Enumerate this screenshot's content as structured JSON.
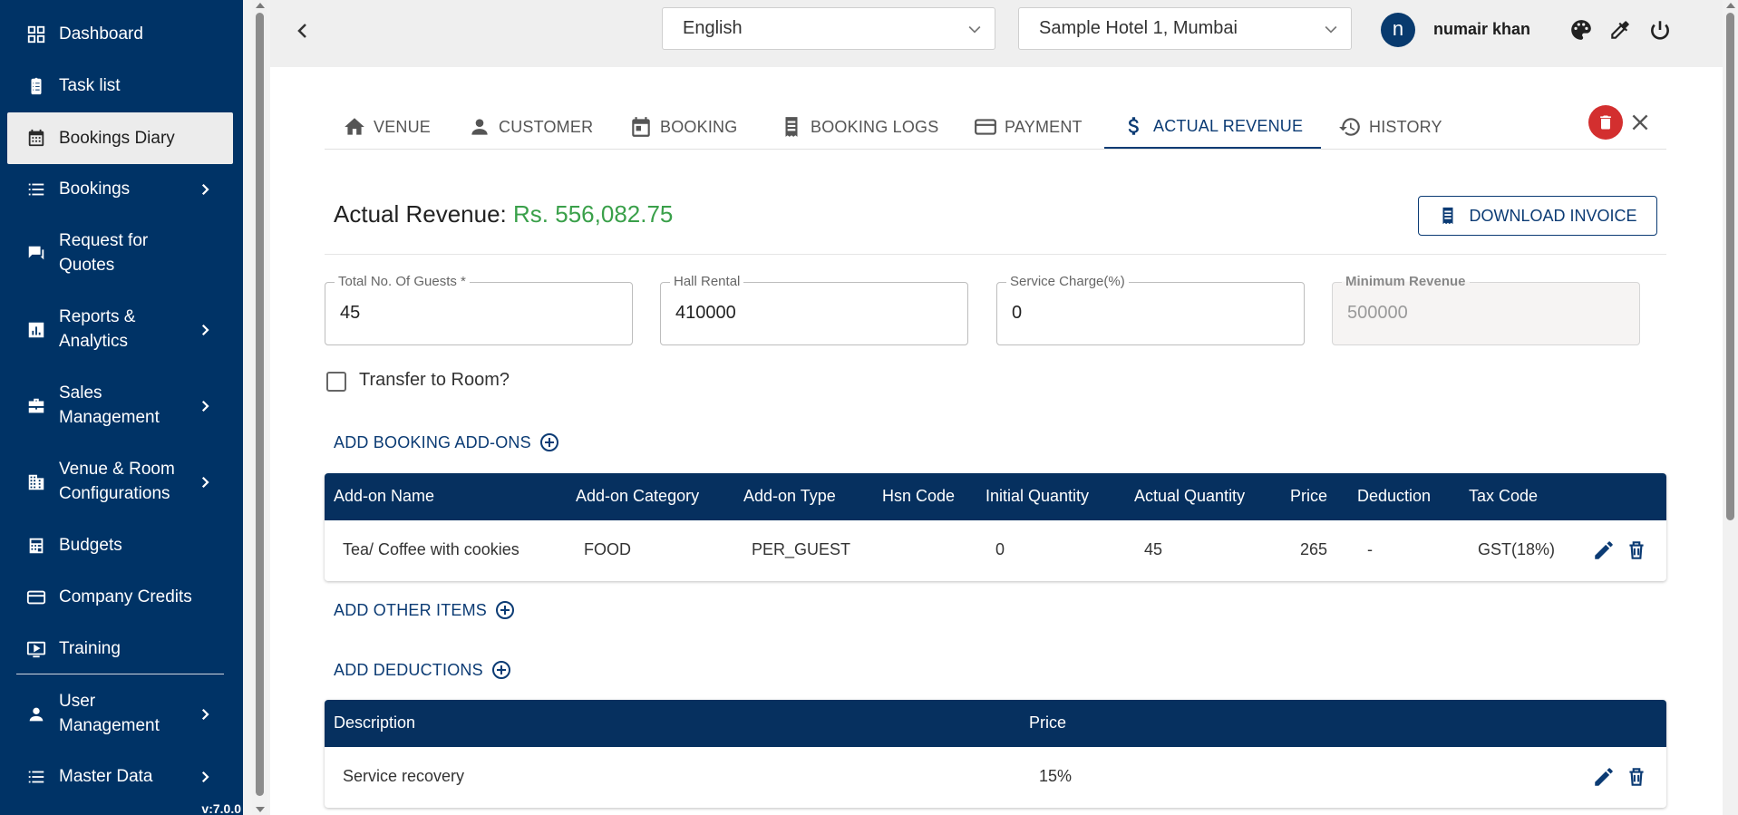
{
  "sidebar": {
    "items": [
      {
        "label": "Dashboard",
        "icon": "dashboard-icon"
      },
      {
        "label": "Task list",
        "icon": "clipboard-icon"
      },
      {
        "label": "Bookings Diary",
        "icon": "calendar-icon"
      },
      {
        "label": "Bookings",
        "icon": "list-icon"
      },
      {
        "label": "Request for Quotes",
        "icon": "chat-icon"
      },
      {
        "label": "Reports & Analytics",
        "icon": "bar-chart-icon"
      },
      {
        "label": "Sales Management",
        "icon": "briefcase-icon"
      },
      {
        "label": "Venue & Room Configurations",
        "icon": "building-icon"
      },
      {
        "label": "Budgets",
        "icon": "calculator-icon"
      },
      {
        "label": "Company Credits",
        "icon": "credit-card-icon"
      },
      {
        "label": "Training",
        "icon": "video-icon"
      },
      {
        "label": "User Management",
        "icon": "person-icon"
      },
      {
        "label": "Master Data",
        "icon": "list-icon"
      }
    ],
    "version": "v:7.0.0"
  },
  "topbar": {
    "language": "English",
    "hotel": "Sample Hotel 1, Mumbai",
    "avatar_letter": "n",
    "username": "numair khan"
  },
  "tabs": [
    {
      "label": "VENUE",
      "icon": "home-icon"
    },
    {
      "label": "CUSTOMER",
      "icon": "person-icon"
    },
    {
      "label": "BOOKING",
      "icon": "calendar-icon"
    },
    {
      "label": "BOOKING LOGS",
      "icon": "receipt-icon"
    },
    {
      "label": "PAYMENT",
      "icon": "credit-card-icon"
    },
    {
      "label": "ACTUAL REVENUE",
      "icon": "dollar-icon"
    },
    {
      "label": "HISTORY",
      "icon": "history-icon"
    }
  ],
  "active_tab": "ACTUAL REVENUE",
  "revenue": {
    "label": "Actual Revenue:",
    "amount": "Rs. 556,082.75",
    "download_label": "DOWNLOAD INVOICE"
  },
  "fields": {
    "guests": {
      "label": "Total No. Of Guests *",
      "value": "45"
    },
    "hall_rental": {
      "label": "Hall Rental",
      "value": "410000"
    },
    "service_charge": {
      "label": "Service Charge(%)",
      "value": "0"
    },
    "min_revenue": {
      "label": "Minimum Revenue",
      "value": "500000"
    }
  },
  "transfer_label": "Transfer to Room?",
  "transfer_checked": false,
  "links": {
    "add_addons": "ADD BOOKING ADD-ONS",
    "add_other": "ADD OTHER ITEMS",
    "add_deductions": "ADD DEDUCTIONS"
  },
  "addons_table": {
    "headers": [
      "Add-on Name",
      "Add-on Category",
      "Add-on Type",
      "Hsn Code",
      "Initial Quantity",
      "Actual Quantity",
      "Price",
      "Deduction",
      "Tax Code"
    ],
    "rows": [
      [
        "Tea/ Coffee with cookies",
        "FOOD",
        "PER_GUEST",
        "",
        "0",
        "45",
        "265",
        "-",
        "GST(18%)"
      ]
    ]
  },
  "deductions_table": {
    "headers": [
      "Description",
      "Price"
    ],
    "rows": [
      [
        "Service recovery",
        "15%"
      ]
    ]
  },
  "colors": {
    "sidebar": "#003366",
    "accent": "#0b3b74",
    "table_header": "#06305f",
    "amount": "#3aa04a",
    "delete": "#d32f2f"
  }
}
